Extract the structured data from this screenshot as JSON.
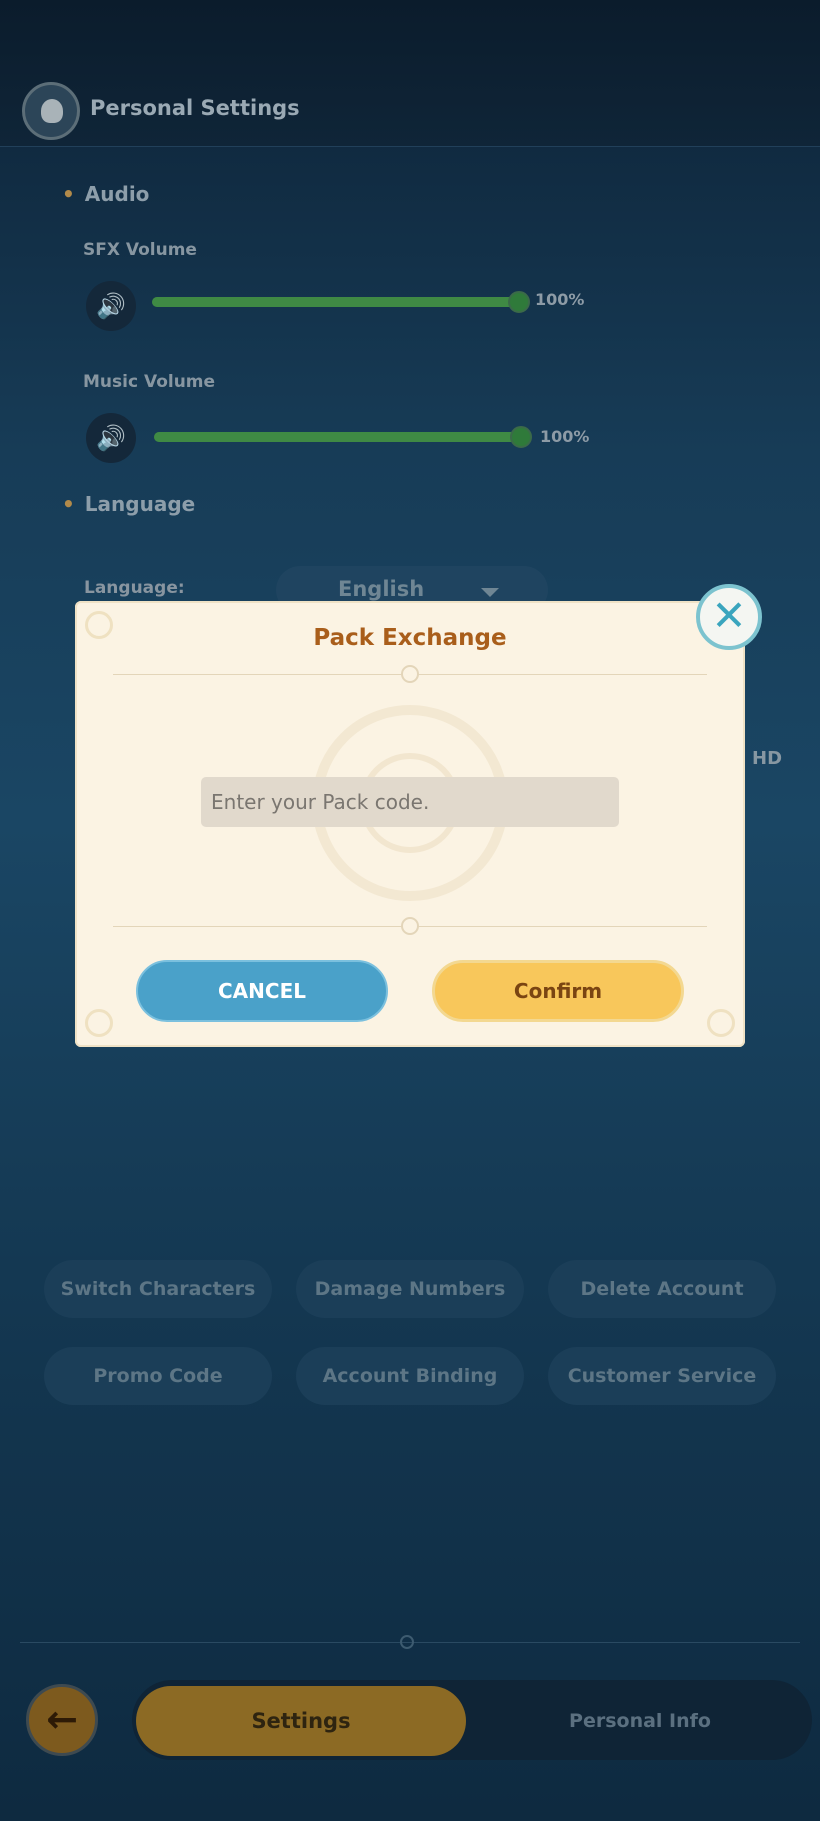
{
  "header": {
    "title": "Personal Settings",
    "icon": "character-avatar-icon"
  },
  "audio": {
    "section_label": "Audio",
    "sfx": {
      "label": "SFX Volume",
      "value_text": "100%",
      "level": 1.0
    },
    "music": {
      "label": "Music Volume",
      "value_text": "100%",
      "level": 1.0
    }
  },
  "language": {
    "section_label": "Language",
    "field_label": "Language:",
    "selected": "English"
  },
  "graphics": {
    "hd_label": "HD"
  },
  "actions": {
    "switch_characters": "Switch Characters",
    "damage_numbers": "Damage Numbers",
    "delete_account": "Delete Account",
    "promo_code": "Promo Code",
    "account_binding": "Account Binding",
    "customer_service": "Customer Service"
  },
  "bottom_nav": {
    "settings_tab": "Settings",
    "personal_info_tab": "Personal Info"
  },
  "modal": {
    "title": "Pack Exchange",
    "input_placeholder": "Enter your Pack code.",
    "input_value": "",
    "cancel_label": "CANCEL",
    "confirm_label": "Confirm"
  },
  "colors": {
    "accent_gold": "#f8c75b",
    "cancel_blue": "#4aa1c9",
    "modal_title": "#a95e1b",
    "slider_green": "#3f8a44"
  }
}
